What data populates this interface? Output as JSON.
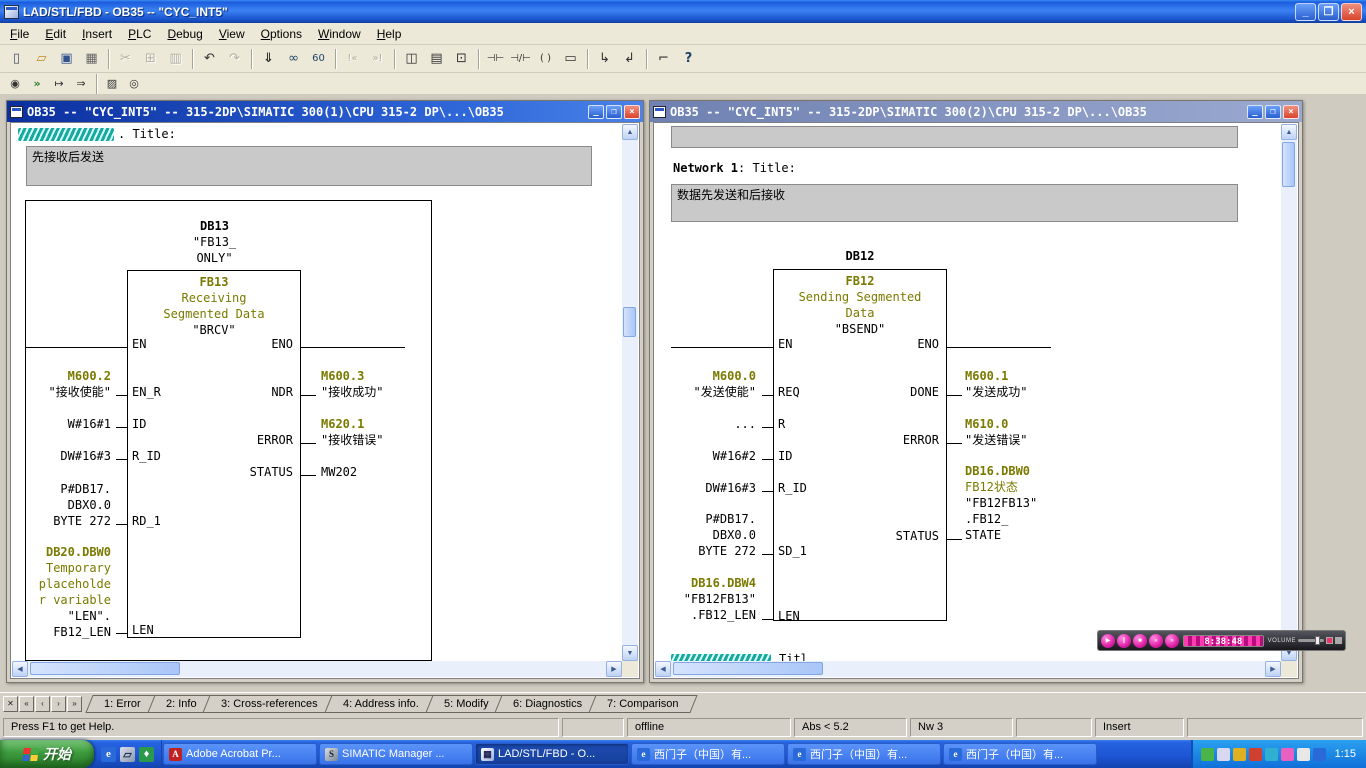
{
  "app": {
    "title": "LAD/STL/FBD  - OB35 -- \"CYC_INT5\""
  },
  "menu": {
    "items": [
      "File",
      "Edit",
      "Insert",
      "PLC",
      "Debug",
      "View",
      "Options",
      "Window",
      "Help"
    ]
  },
  "toolbar1": {
    "buttons": [
      {
        "name": "new",
        "glyph": "▯"
      },
      {
        "name": "open",
        "glyph": "▱"
      },
      {
        "name": "save",
        "glyph": "▣"
      },
      {
        "name": "print",
        "glyph": "▦"
      },
      {
        "name": "cut",
        "glyph": "✂"
      },
      {
        "name": "copy",
        "glyph": "⊞"
      },
      {
        "name": "paste",
        "glyph": "▥"
      },
      {
        "name": "undo",
        "glyph": "↶"
      },
      {
        "name": "redo",
        "glyph": "↷"
      },
      {
        "name": "download",
        "glyph": "⇓"
      },
      {
        "name": "monitor",
        "glyph": "∞"
      },
      {
        "name": "monitor-60",
        "glyph": "60"
      },
      {
        "name": "prev-error",
        "glyph": "!«"
      },
      {
        "name": "next-error",
        "glyph": "»!"
      },
      {
        "name": "split-window",
        "glyph": "◫"
      },
      {
        "name": "overview",
        "glyph": "▤"
      },
      {
        "name": "detail-view",
        "glyph": "⊡"
      },
      {
        "name": "contact-no",
        "glyph": "⊣⊢"
      },
      {
        "name": "contact-nc",
        "glyph": "⊣/⊢"
      },
      {
        "name": "coil",
        "glyph": "( )"
      },
      {
        "name": "empty-box",
        "glyph": "▭"
      },
      {
        "name": "open-branch",
        "glyph": "↳"
      },
      {
        "name": "close-branch",
        "glyph": "↲"
      },
      {
        "name": "negate",
        "glyph": "⌐"
      },
      {
        "name": "context-help",
        "glyph": "?"
      }
    ]
  },
  "toolbar2": {
    "buttons": [
      {
        "name": "insert-network",
        "glyph": "◉"
      },
      {
        "name": "program-elements",
        "glyph": "»"
      },
      {
        "name": "goto",
        "glyph": "↦"
      },
      {
        "name": "next-address",
        "glyph": "⇒"
      },
      {
        "name": "symbol-info",
        "glyph": "▨"
      },
      {
        "name": "watch",
        "glyph": "◎"
      }
    ]
  },
  "left_win": {
    "title": "OB35 -- \"CYC_INT5\" -- 315-2DP\\SIMATIC 300(1)\\CPU 315-2 DP\\...\\OB35",
    "partial_title": ". Title:",
    "comment": "先接收后发送",
    "db": "DB13",
    "inst1": "\"FB13_",
    "inst2": "ONLY\"",
    "fb": "FB13",
    "desc1": "Receiving",
    "desc2": "Segmented Data",
    "sym": "\"BRCV\"",
    "pins_left": [
      "EN",
      "EN_R",
      "ID",
      "R_ID",
      "RD_1",
      "LEN"
    ],
    "pins_right": [
      "ENO",
      "NDR",
      "ERROR",
      "STATUS"
    ],
    "ops_left": [
      "M600.2",
      "\"接收使能\"",
      "W#16#1",
      "DW#16#3",
      "P#DB17.",
      "DBX0.0",
      "BYTE 272",
      "DB20.DBW0",
      "Temporary",
      "placeholde",
      "r variable",
      "\"LEN\".",
      "FB12_LEN"
    ],
    "ops_right": [
      "M600.3",
      "\"接收成功\"",
      "M620.1",
      "\"接收错误\"",
      "MW202"
    ]
  },
  "right_win": {
    "title": "OB35 -- \"CYC_INT5\" -- 315-2DP\\SIMATIC 300(2)\\CPU 315-2 DP\\...\\OB35",
    "network_label": "Network 1",
    "network_title": ": Title:",
    "comment": "数据先发送和后接收",
    "db": "DB12",
    "fb": "FB12",
    "desc1": "Sending Segmented",
    "desc2": "Data",
    "sym": "\"BSEND\"",
    "pins_left": [
      "EN",
      "REQ",
      "R",
      "ID",
      "R_ID",
      "SD_1",
      "LEN"
    ],
    "pins_right": [
      "ENO",
      "DONE",
      "ERROR",
      "STATUS"
    ],
    "ops_left": [
      "M600.0",
      "\"发送使能\"",
      "...",
      "W#16#2",
      "DW#16#3",
      "P#DB17.",
      "DBX0.0",
      "BYTE 272",
      "DB16.DBW4",
      "\"FB12FB13\"",
      ".FB12_LEN"
    ],
    "ops_right": [
      "M600.1",
      "\"发送成功\"",
      "M610.0",
      "\"发送错误\"",
      "DB16.DBW0",
      "FB12状态",
      "\"FB12FB13\"",
      ".FB12_",
      "STATE"
    ],
    "partial_bottom": "Titl"
  },
  "player": {
    "time": "8:38:48",
    "volume": "VOLUME",
    "buttons": [
      "▶",
      "∥",
      "■",
      "«",
      "»"
    ]
  },
  "tabbar": {
    "nav": [
      "✕",
      "«",
      "‹",
      "›",
      "»"
    ],
    "tabs": [
      "1: Error",
      "2: Info",
      "3: Cross-references",
      "4: Address info.",
      "5: Modify",
      "6: Diagnostics",
      "7: Comparison"
    ]
  },
  "statusbar": {
    "help": "Press F1 to get Help.",
    "mode": "offline",
    "abs": "Abs < 5.2",
    "nw": "Nw 3",
    "insert": "Insert"
  },
  "taskbar": {
    "start": "开始",
    "tasks": [
      "Adobe Acrobat Pr...",
      "SIMATIC Manager ...",
      "LAD/STL/FBD - O...",
      "西门子（中国）有...",
      "西门子（中国）有...",
      "西门子（中国）有..."
    ],
    "clock": "1:15"
  }
}
